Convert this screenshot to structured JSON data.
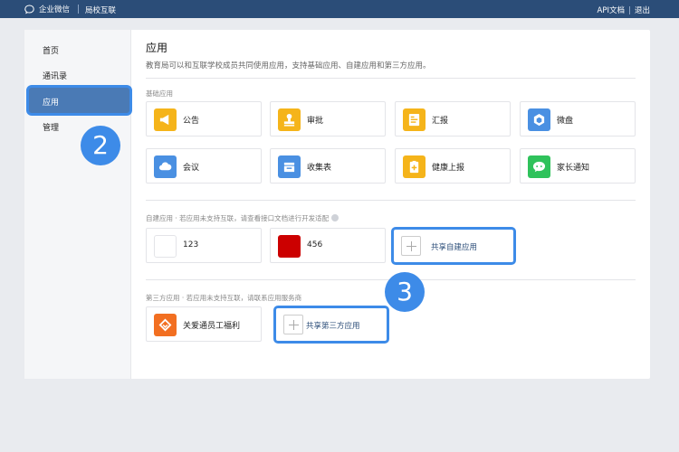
{
  "topbar": {
    "brand": "企业微信",
    "subtitle": "局校互联",
    "links": [
      "API文档",
      "退出"
    ]
  },
  "sidebar": {
    "items": [
      {
        "label": "首页"
      },
      {
        "label": "通讯录"
      },
      {
        "label": "应用",
        "active": true
      },
      {
        "label": "管理"
      }
    ]
  },
  "badges": [
    "2",
    "3"
  ],
  "main": {
    "title": "应用",
    "description": "教育局可以和互联学校成员共同使用应用，支持基础应用、自建应用和第三方应用。",
    "sections": {
      "basic": {
        "label": "基础应用",
        "apps": [
          {
            "label": "公告",
            "icon": "megaphone-icon",
            "color": "#f5b41a"
          },
          {
            "label": "审批",
            "icon": "stamp-icon",
            "color": "#f5b41a"
          },
          {
            "label": "汇报",
            "icon": "report-icon",
            "color": "#f5b41a"
          },
          {
            "label": "微盘",
            "icon": "cloud-drive-icon",
            "color": "#4a90e2"
          },
          {
            "label": "会议",
            "icon": "cloud-meeting-icon",
            "color": "#4a90e2"
          },
          {
            "label": "收集表",
            "icon": "form-icon",
            "color": "#4a90e2"
          },
          {
            "label": "健康上报",
            "icon": "health-report-icon",
            "color": "#f5b41a"
          },
          {
            "label": "家长通知",
            "icon": "chat-icon",
            "color": "#2fc25b"
          }
        ]
      },
      "custom": {
        "label": "自建应用 · 若应用未支持互联，请查看接口文档进行开发适配",
        "apps": [
          {
            "label": "123",
            "color": "#ffffff"
          },
          {
            "label": "456",
            "color": "#cc0000"
          }
        ],
        "add_label": "共享自建应用"
      },
      "third_party": {
        "label": "第三方应用 · 若应用未支持互联，请联系应用服务商",
        "apps": [
          {
            "label": "关爱通员工福利",
            "icon": "gift-icon",
            "color": "#f26f21"
          }
        ],
        "add_label": "共享第三方应用"
      }
    }
  }
}
